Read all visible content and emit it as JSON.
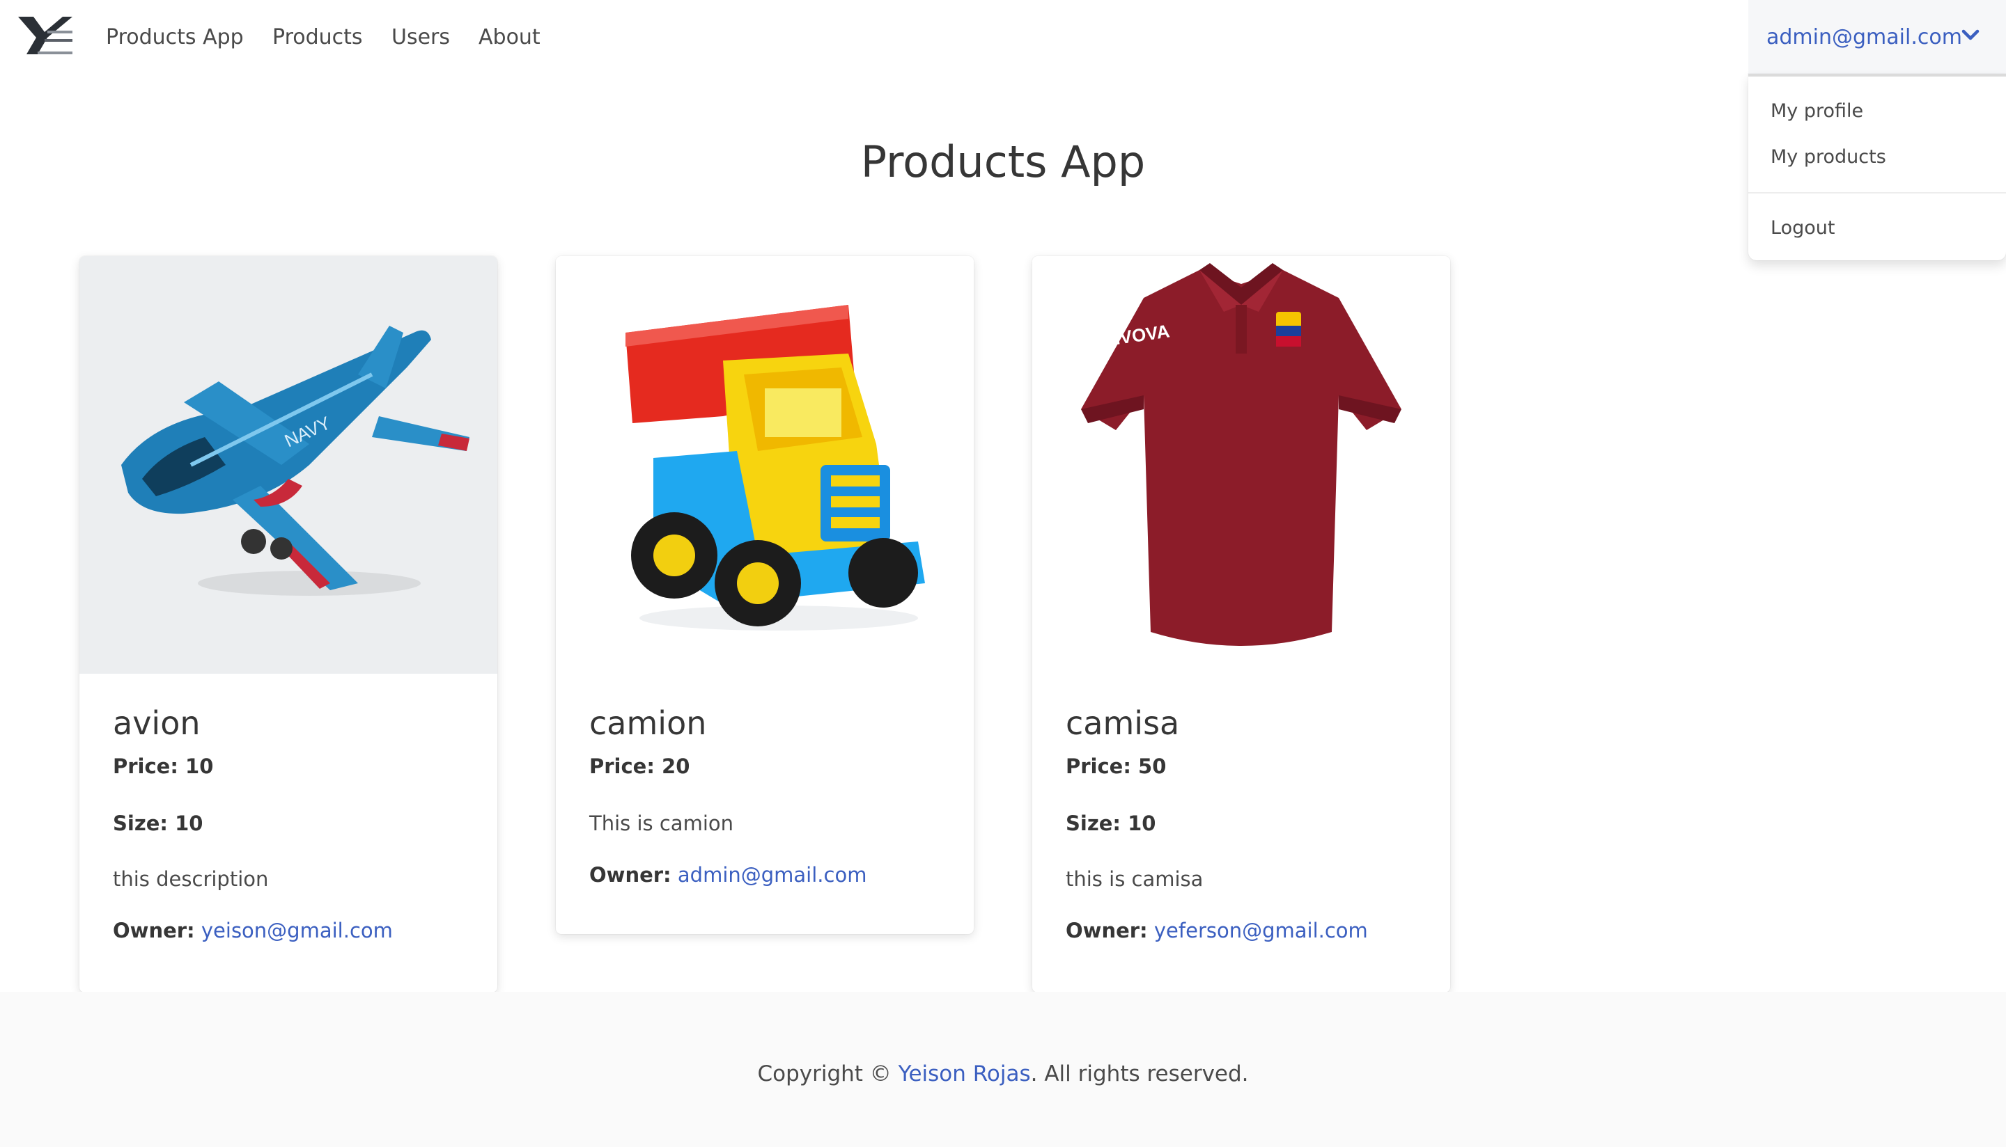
{
  "navbar": {
    "logo_icon": "yr-logo-icon",
    "items": [
      {
        "label": "Products App"
      },
      {
        "label": "Products"
      },
      {
        "label": "Users"
      },
      {
        "label": "About"
      }
    ],
    "user_email": "admin@gmail.com",
    "user_chevron_icon": "chevron-down-icon"
  },
  "dropdown": {
    "items": [
      {
        "label": "My profile"
      },
      {
        "label": "My products"
      }
    ],
    "logout_label": "Logout"
  },
  "main": {
    "title": "Products App"
  },
  "products": [
    {
      "name": "avion",
      "price_label": "Price: 10",
      "size_label": "Size: 10",
      "description": "this description",
      "owner_label": "Owner:",
      "owner_email": "yeison@gmail.com",
      "image_icon": "toy-airplane-image"
    },
    {
      "name": "camion",
      "price_label": "Price: 20",
      "description": "This is camion",
      "owner_label": "Owner:",
      "owner_email": "admin@gmail.com",
      "image_icon": "toy-truck-image"
    },
    {
      "name": "camisa",
      "price_label": "Price: 50",
      "size_label": "Size: 10",
      "description": "this is camisa",
      "owner_label": "Owner:",
      "owner_email": "yeferson@gmail.com",
      "image_icon": "red-shirt-image",
      "image_text": "GIVOVA"
    }
  ],
  "footer": {
    "prefix": "Copyright © ",
    "author": "Yeison Rojas",
    "suffix": ". All rights reserved."
  },
  "colors": {
    "link": "#3b5fc0",
    "text": "#363636",
    "footer_bg": "#fafafa"
  }
}
